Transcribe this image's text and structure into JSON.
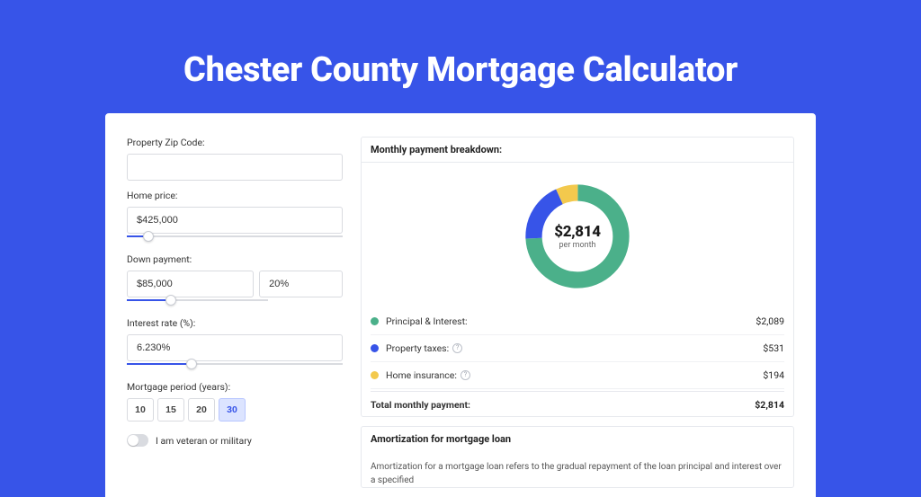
{
  "title": "Chester County Mortgage Calculator",
  "form": {
    "zip_label": "Property Zip Code:",
    "zip_value": "",
    "home_price_label": "Home price:",
    "home_price_value": "$425,000",
    "home_price_slider_pct": 10,
    "down_payment_label": "Down payment:",
    "down_payment_value": "$85,000",
    "down_payment_pct_value": "20%",
    "down_payment_slider_pct": 20,
    "interest_label": "Interest rate (%):",
    "interest_value": "6.230%",
    "interest_slider_pct": 30,
    "period_label": "Mortgage period (years):",
    "period_options": [
      "10",
      "15",
      "20",
      "30"
    ],
    "period_selected_index": 3,
    "veteran_label": "I am veteran or military",
    "veteran_on": false
  },
  "breakdown": {
    "header": "Monthly payment breakdown:",
    "center_value": "$2,814",
    "center_sub": "per month",
    "items": [
      {
        "label": "Principal & Interest:",
        "value": "$2,089",
        "color": "#4bb08a",
        "info": false
      },
      {
        "label": "Property taxes:",
        "value": "$531",
        "color": "#3754e8",
        "info": true
      },
      {
        "label": "Home insurance:",
        "value": "$194",
        "color": "#f3c94d",
        "info": true
      }
    ],
    "total_label": "Total monthly payment:",
    "total_value": "$2,814"
  },
  "chart_data": {
    "type": "pie",
    "title": "Monthly payment breakdown",
    "categories": [
      "Principal & Interest",
      "Property taxes",
      "Home insurance"
    ],
    "values": [
      2089,
      531,
      194
    ],
    "colors": [
      "#4bb08a",
      "#3754e8",
      "#f3c94d"
    ],
    "total": 2814
  },
  "amort": {
    "header": "Amortization for mortgage loan",
    "text": "Amortization for a mortgage loan refers to the gradual repayment of the loan principal and interest over a specified"
  }
}
